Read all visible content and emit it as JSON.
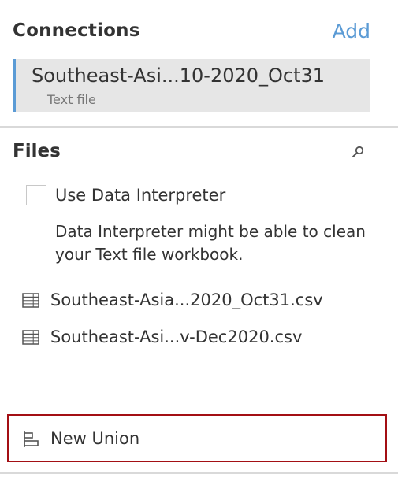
{
  "connections": {
    "title": "Connections",
    "add_label": "Add",
    "items": [
      {
        "name": "Southeast-Asi...10-2020_Oct31",
        "type": "Text file"
      }
    ]
  },
  "files": {
    "title": "Files",
    "search_icon": "search-icon",
    "data_interpreter": {
      "label": "Use Data Interpreter",
      "checked": false,
      "description": "Data Interpreter might be able to clean your Text file workbook."
    },
    "items": [
      {
        "label": "Southeast-Asia...2020_Oct31.csv",
        "icon": "table-icon"
      },
      {
        "label": "Southeast-Asi...v-Dec2020.csv",
        "icon": "table-icon"
      }
    ],
    "new_union_label": "New Union",
    "new_union_icon": "union-icon"
  },
  "colors": {
    "accent": "#5b9bd5",
    "highlight_border": "#a30f14"
  }
}
